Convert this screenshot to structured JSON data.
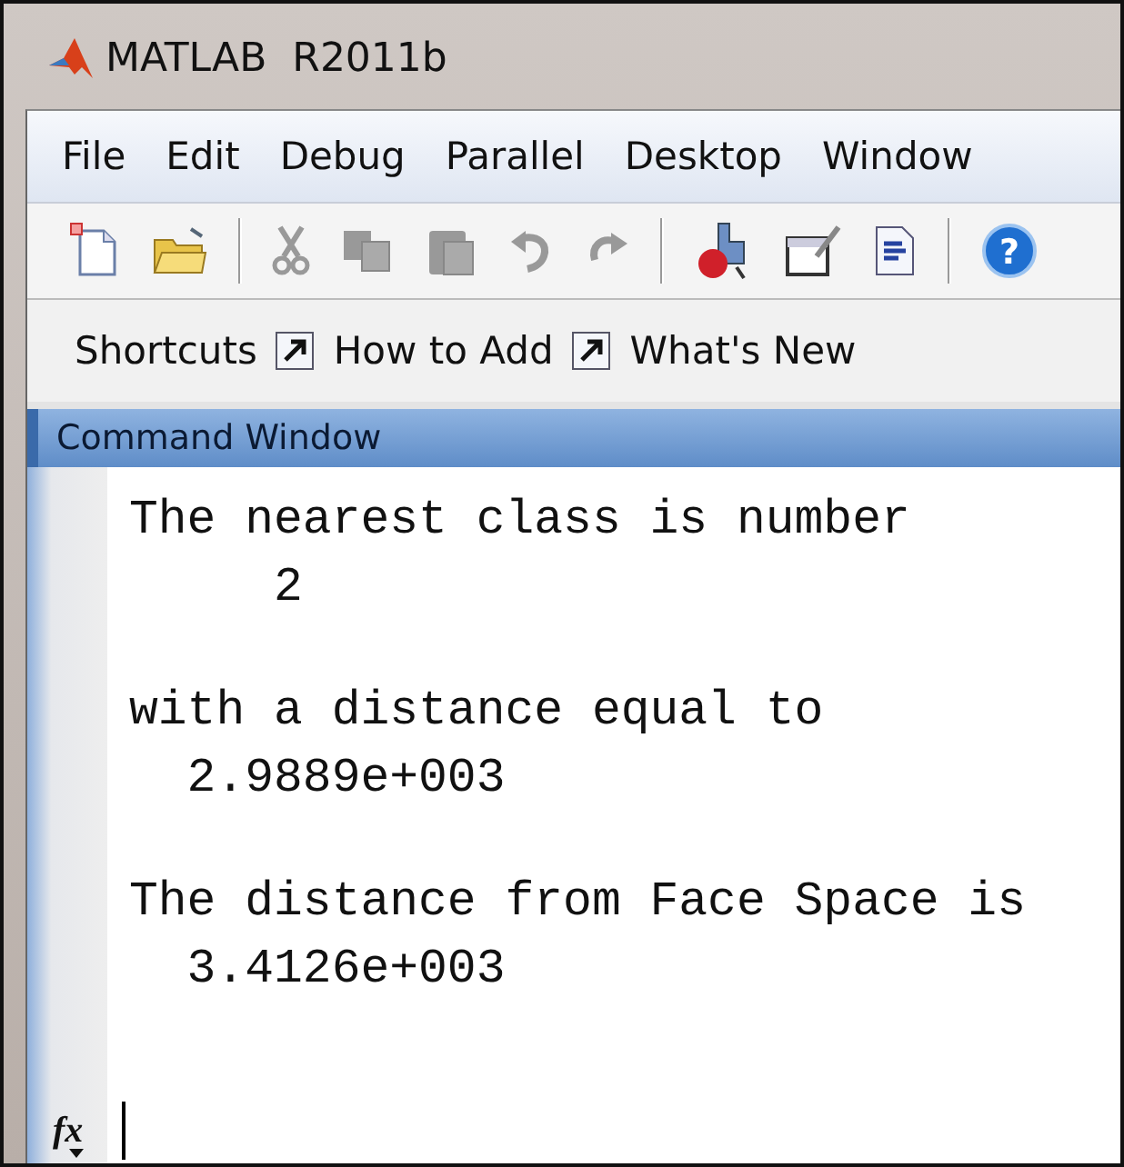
{
  "window": {
    "title": "MATLAB  R2011b"
  },
  "menu": [
    "File",
    "Edit",
    "Debug",
    "Parallel",
    "Desktop",
    "Window"
  ],
  "toolbar": {
    "help_glyph": "?"
  },
  "shortcuts": {
    "label": "Shortcuts",
    "links": [
      "How to Add",
      "What's New"
    ]
  },
  "command_window": {
    "title": "Command Window",
    "function_glyph": "fx",
    "blocks": [
      {
        "lines": [
          "The nearest class is number",
          "     2"
        ]
      },
      {
        "lines": [
          "with a distance equal to",
          "  2.9889e+003"
        ]
      },
      {
        "lines": [
          "The distance from Face Space is",
          "  3.4126e+003"
        ]
      }
    ]
  }
}
